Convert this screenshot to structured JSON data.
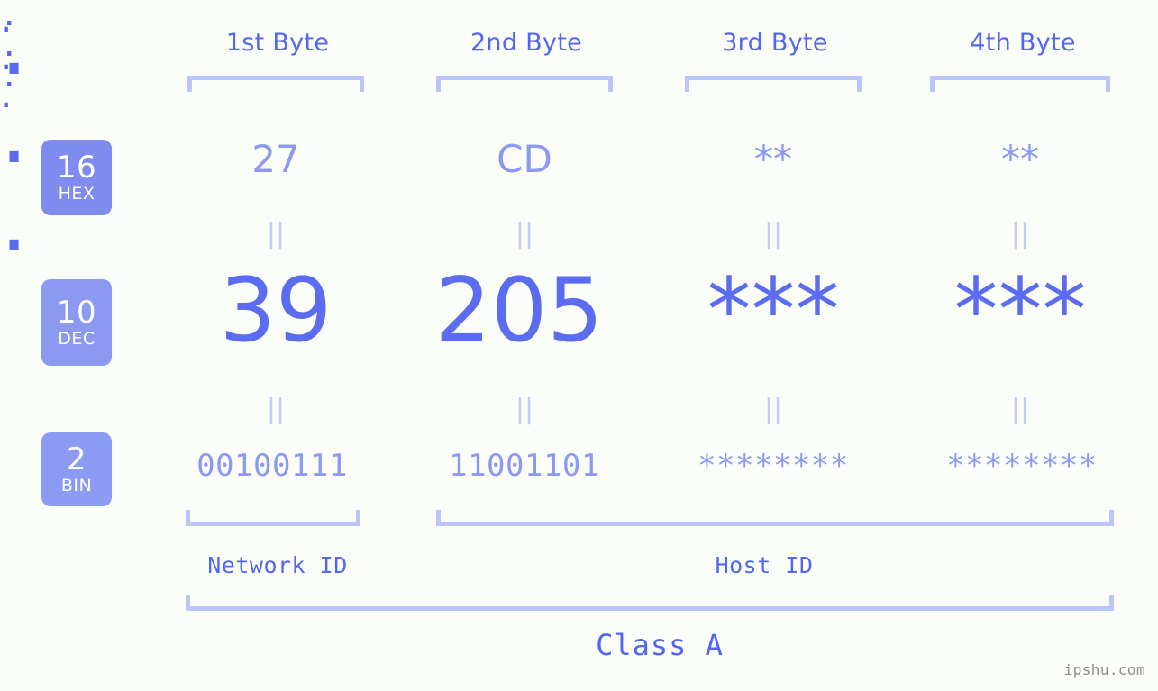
{
  "watermark": "ipshu.com",
  "byte_headers": [
    {
      "label": "1st Byte"
    },
    {
      "label": "2nd Byte"
    },
    {
      "label": "3rd Byte"
    },
    {
      "label": "4th Byte"
    }
  ],
  "bases": [
    {
      "num": "16",
      "name": "HEX"
    },
    {
      "num": "10",
      "name": "DEC"
    },
    {
      "num": "2",
      "name": "BIN"
    }
  ],
  "separator": ".",
  "equality_mark": "||",
  "rows": {
    "hex": {
      "values": [
        "27",
        "CD",
        "**",
        "**"
      ]
    },
    "dec": {
      "values": [
        "39",
        "205",
        "***",
        "***"
      ]
    },
    "bin": {
      "values": [
        "00100111",
        "11001101",
        "********",
        "********"
      ]
    }
  },
  "segments": {
    "network_id": "Network ID",
    "host_id": "Host ID",
    "class": "Class A"
  },
  "colors": {
    "background": "#fbfdf8",
    "accent_strong": "#5166f2",
    "accent_light": "#8c99f3",
    "bracket": "#bcc5f9",
    "badge_hex": "#7d8cee",
    "badge_dec": "#8b99f1",
    "badge_bin": "#8b9bf4",
    "equality": "#c3ccf9",
    "watermark": "#8d8d8d"
  }
}
